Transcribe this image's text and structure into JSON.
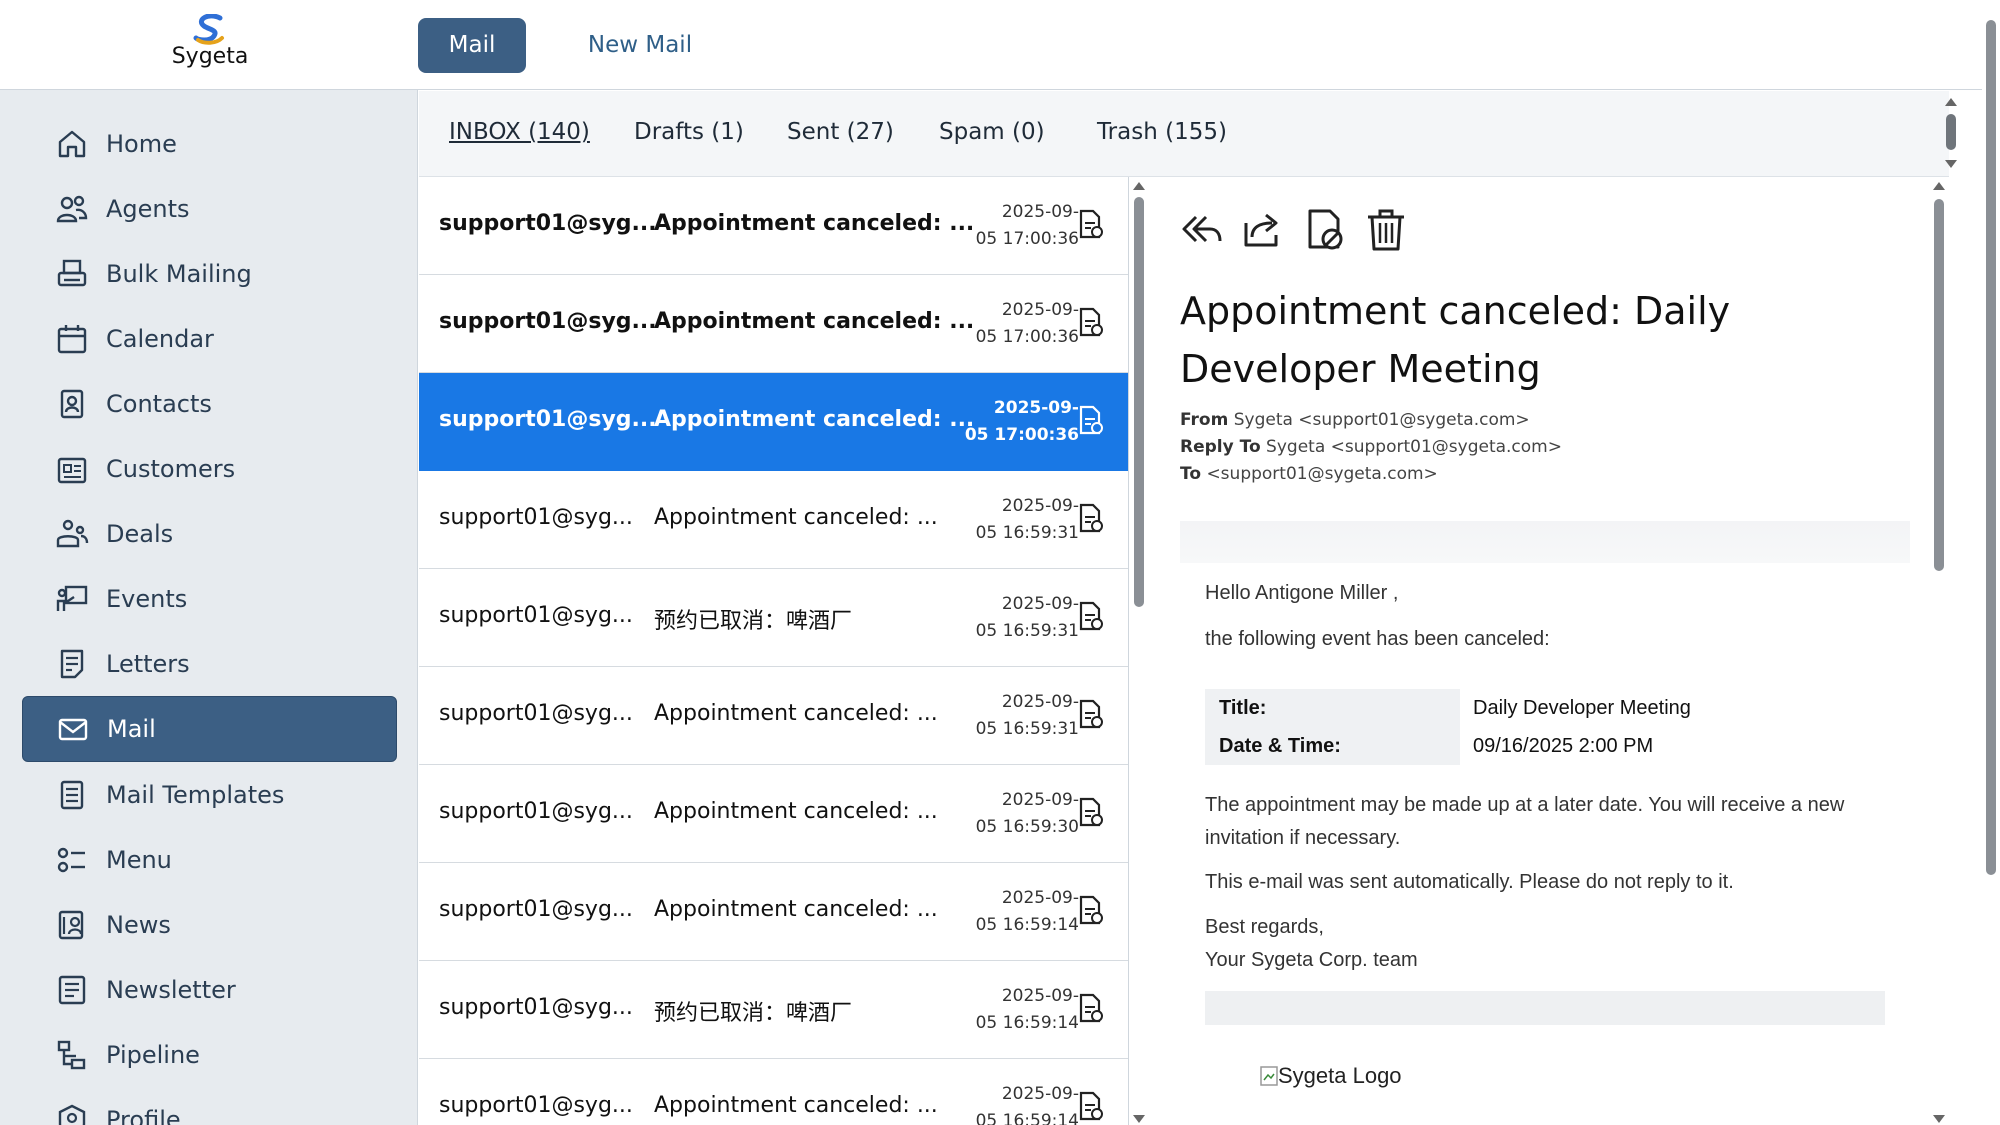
{
  "brand": {
    "name": "Sygeta"
  },
  "top_tabs": [
    {
      "label": "Mail",
      "active": true
    },
    {
      "label": "New Mail",
      "active": false
    }
  ],
  "sidebar": {
    "items": [
      {
        "label": "Home",
        "icon": "home-icon"
      },
      {
        "label": "Agents",
        "icon": "users-icon"
      },
      {
        "label": "Bulk Mailing",
        "icon": "printer-icon"
      },
      {
        "label": "Calendar",
        "icon": "calendar-icon"
      },
      {
        "label": "Contacts",
        "icon": "contact-card-icon"
      },
      {
        "label": "Customers",
        "icon": "customers-icon"
      },
      {
        "label": "Deals",
        "icon": "deals-icon"
      },
      {
        "label": "Events",
        "icon": "presentation-icon"
      },
      {
        "label": "Letters",
        "icon": "letter-icon"
      },
      {
        "label": "Mail",
        "icon": "mail-icon",
        "active": true
      },
      {
        "label": "Mail Templates",
        "icon": "template-icon"
      },
      {
        "label": "Menu",
        "icon": "menu-list-icon"
      },
      {
        "label": "News",
        "icon": "news-icon"
      },
      {
        "label": "Newsletter",
        "icon": "newsletter-icon"
      },
      {
        "label": "Pipeline",
        "icon": "pipeline-icon"
      },
      {
        "label": "Profile",
        "icon": "profile-icon"
      }
    ]
  },
  "folders": [
    {
      "label": "INBOX (140)",
      "active": true
    },
    {
      "label": "Drafts (1)"
    },
    {
      "label": "Sent (27)"
    },
    {
      "label": "Spam (0)"
    },
    {
      "label": "Trash (155)"
    }
  ],
  "messages": [
    {
      "from": "support01@syg...",
      "subject": "Appointment canceled: ...",
      "date1": "2025-09-",
      "date2": "05 17:00:36",
      "unread": true
    },
    {
      "from": "support01@syg...",
      "subject": "Appointment canceled: ...",
      "date1": "2025-09-",
      "date2": "05 17:00:36",
      "unread": true
    },
    {
      "from": "support01@syg...",
      "subject": "Appointment canceled: ...",
      "date1": "2025-09-",
      "date2": "05 17:00:36",
      "selected": true
    },
    {
      "from": "support01@syg...",
      "subject": "Appointment canceled: ...",
      "date1": "2025-09-",
      "date2": "05 16:59:31"
    },
    {
      "from": "support01@syg...",
      "subject": "预约已取消：啤酒厂",
      "date1": "2025-09-",
      "date2": "05 16:59:31"
    },
    {
      "from": "support01@syg...",
      "subject": "Appointment canceled: ...",
      "date1": "2025-09-",
      "date2": "05 16:59:31"
    },
    {
      "from": "support01@syg...",
      "subject": "Appointment canceled: ...",
      "date1": "2025-09-",
      "date2": "05 16:59:30"
    },
    {
      "from": "support01@syg...",
      "subject": "Appointment canceled: ...",
      "date1": "2025-09-",
      "date2": "05 16:59:14"
    },
    {
      "from": "support01@syg...",
      "subject": "预约已取消：啤酒厂",
      "date1": "2025-09-",
      "date2": "05 16:59:14"
    },
    {
      "from": "support01@syg...",
      "subject": "Appointment canceled: ...",
      "date1": "2025-09-",
      "date2": "05 16:59:14"
    }
  ],
  "reader": {
    "subject": "Appointment canceled: Daily Developer Meeting",
    "from_label": "From",
    "from_value": "Sygeta <support01@sygeta.com>",
    "reply_label": "Reply To",
    "reply_value": "Sygeta <support01@sygeta.com>",
    "to_label": "To",
    "to_value": "<support01@sygeta.com>",
    "greeting": "Hello Antigone Miller ,",
    "intro": "the following event has been canceled:",
    "event_title_label": "Title:",
    "event_title_value": "Daily Developer Meeting",
    "event_date_label": "Date & Time:",
    "event_date_value": "09/16/2025 2:00 PM",
    "para1_line1": "The appointment may be made up at a later date. You will receive a new",
    "para1_line2": "invitation if necessary.",
    "para2": "This e-mail was sent automatically. Please do not reply to it.",
    "regards": "Best regards,",
    "signature": "Your Sygeta Corp. team",
    "logo_alt": "Sygeta Logo"
  },
  "colors": {
    "primary": "#3c5f84",
    "selected_row": "#1978e5",
    "sidebar_bg": "#e7ebef"
  }
}
